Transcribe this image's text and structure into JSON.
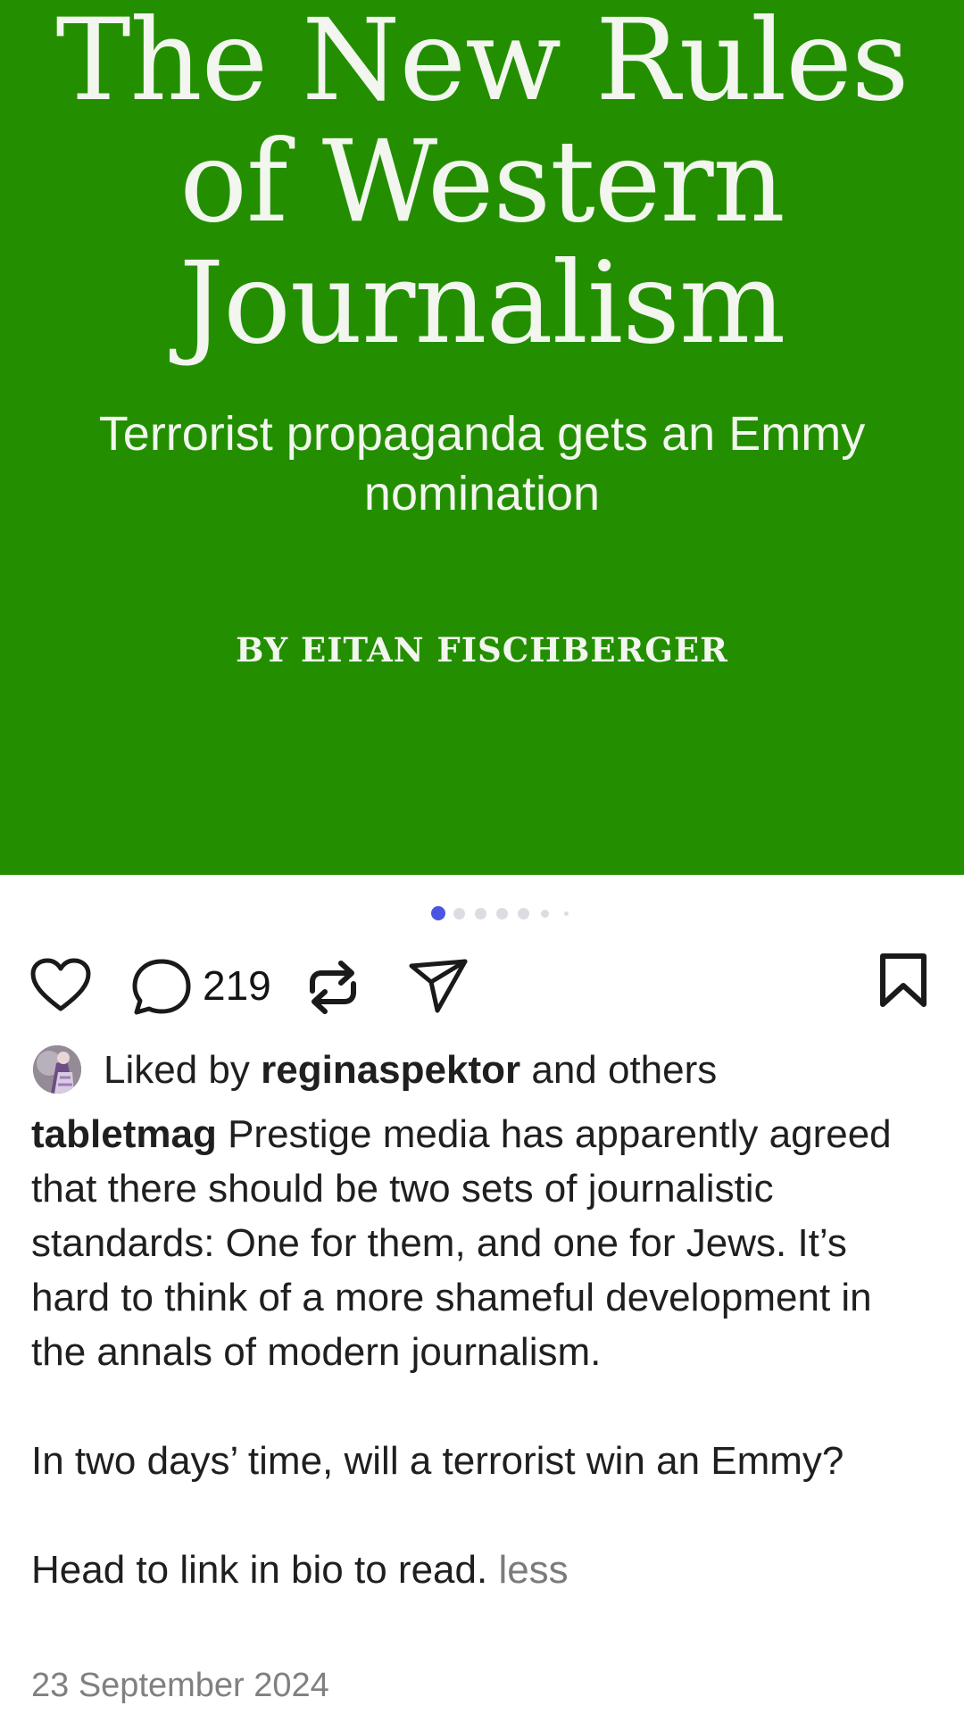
{
  "post": {
    "image": {
      "title": "The New Rules of Western Journalism",
      "subtitle": "Terrorist propaganda gets an Emmy nomination",
      "byline": "BY EITAN FISCHBERGER",
      "background_color": "#238f00"
    },
    "carousel": {
      "current_index": 1,
      "visible_dots": 7,
      "active_color": "#4b56e0",
      "inactive_color": "#dcdde3"
    },
    "actions": {
      "like_icon": "heart-icon",
      "comment_icon": "comment-icon",
      "comment_count": "219",
      "repost_icon": "repost-icon",
      "share_icon": "send-icon",
      "save_icon": "bookmark-icon"
    },
    "likes": {
      "prefix": "Liked by",
      "username": "reginaspektor",
      "suffix": "and others"
    },
    "caption": {
      "username": "tabletmag",
      "paragraph_1": "Prestige media has apparently agreed that there should be two sets of journalistic standards: One for them, and one for Jews. It’s hard to think of a more shameful development in the annals of modern journalism.",
      "paragraph_2": "In two days’ time, will a terrorist win an Emmy?",
      "paragraph_3": "Head to link in bio to read.",
      "less_label": "less"
    },
    "date": "23 September 2024"
  }
}
